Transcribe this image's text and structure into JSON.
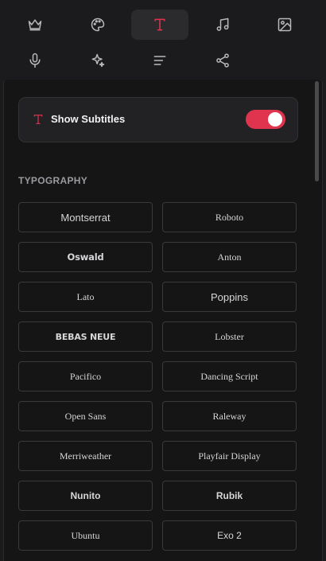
{
  "toolbar": {
    "tools": [
      {
        "name": "crown",
        "active": false
      },
      {
        "name": "palette",
        "active": false
      },
      {
        "name": "typography",
        "active": true
      },
      {
        "name": "music",
        "active": false
      },
      {
        "name": "image",
        "active": false
      },
      {
        "name": "microphone",
        "active": false
      },
      {
        "name": "sparkles",
        "active": false
      },
      {
        "name": "text-align",
        "active": false
      },
      {
        "name": "share",
        "active": false
      }
    ]
  },
  "subtitles": {
    "label": "Show Subtitles",
    "enabled": true
  },
  "typography": {
    "section_title": "TYPOGRAPHY",
    "fonts": [
      "Montserrat",
      "Roboto",
      "Oswald",
      "Anton",
      "Lato",
      "Poppins",
      "BEBAS NEUE",
      "Lobster",
      "Pacifico",
      "Dancing Script",
      "Open Sans",
      "Raleway",
      "Merriweather",
      "Playfair Display",
      "Nunito",
      "Rubik",
      "Ubuntu",
      "Exo 2"
    ]
  },
  "colors": {
    "accent": "#e0344e",
    "background": "#151516",
    "card": "#222225"
  }
}
